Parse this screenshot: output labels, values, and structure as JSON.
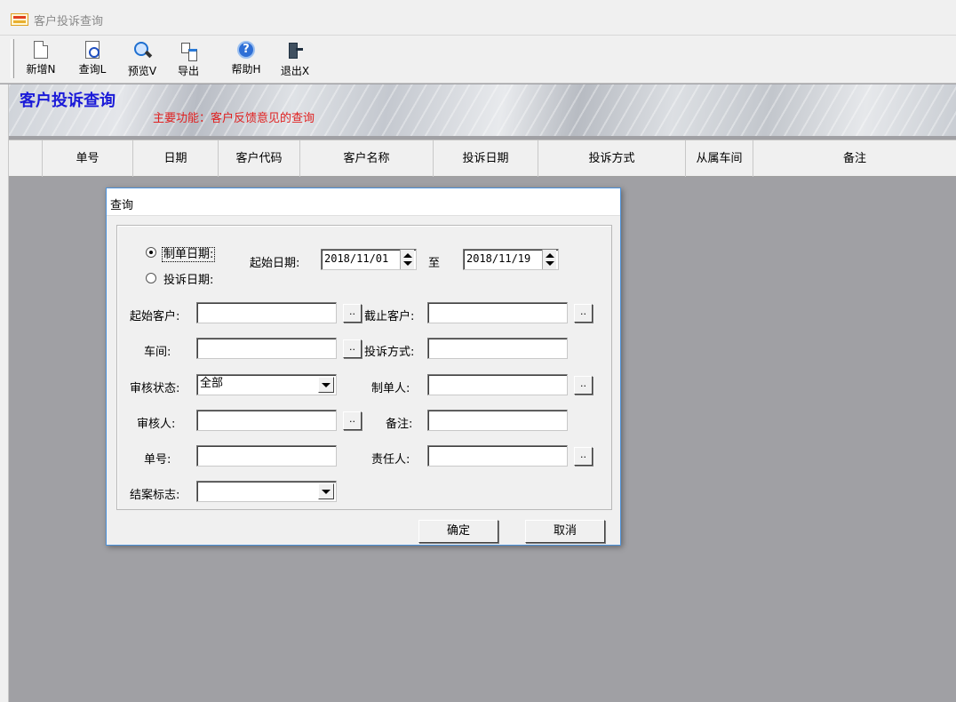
{
  "window": {
    "title": "客户投诉查询"
  },
  "toolbar": {
    "buttons": [
      {
        "label": "新增N",
        "icon": "new-document-icon"
      },
      {
        "label": "查询L",
        "icon": "query-document-icon"
      },
      {
        "label": "预览V",
        "icon": "magnifier-icon"
      },
      {
        "label": "导出",
        "icon": "export-icon"
      },
      {
        "label": "帮助H",
        "icon": "help-icon"
      },
      {
        "label": "退出X",
        "icon": "exit-door-icon"
      }
    ]
  },
  "banner": {
    "title": "客户投诉查询",
    "subtitle": "主要功能：客户反馈意见的查询"
  },
  "grid": {
    "columns": [
      "单号",
      "日期",
      "客户代码",
      "客户名称",
      "投诉日期",
      "投诉方式",
      "从属车间",
      "备注"
    ]
  },
  "dialog": {
    "title": "查询",
    "radio_options": [
      "制单日期:",
      "投诉日期:"
    ],
    "selected_radio": 0,
    "start_date_label": "起始日期:",
    "start_date": "2018/11/01",
    "to_label": "至",
    "end_date": "2018/11/19",
    "fields": {
      "start_customer": {
        "label": "起始客户:",
        "value": ""
      },
      "end_customer": {
        "label": "截止客户:",
        "value": ""
      },
      "workshop": {
        "label": "车间:",
        "value": ""
      },
      "complaint_method": {
        "label": "投诉方式:",
        "value": ""
      },
      "audit_status": {
        "label": "审核状态:",
        "value": "全部"
      },
      "creator": {
        "label": "制单人:",
        "value": ""
      },
      "auditor": {
        "label": "审核人:",
        "value": ""
      },
      "remark": {
        "label": "备注:",
        "value": ""
      },
      "order_no": {
        "label": "单号:",
        "value": ""
      },
      "responsible": {
        "label": "责任人:",
        "value": ""
      },
      "close_flag": {
        "label": "结案标志:",
        "value": ""
      }
    },
    "browse_label": "..",
    "ok_label": "确定",
    "cancel_label": "取消"
  }
}
